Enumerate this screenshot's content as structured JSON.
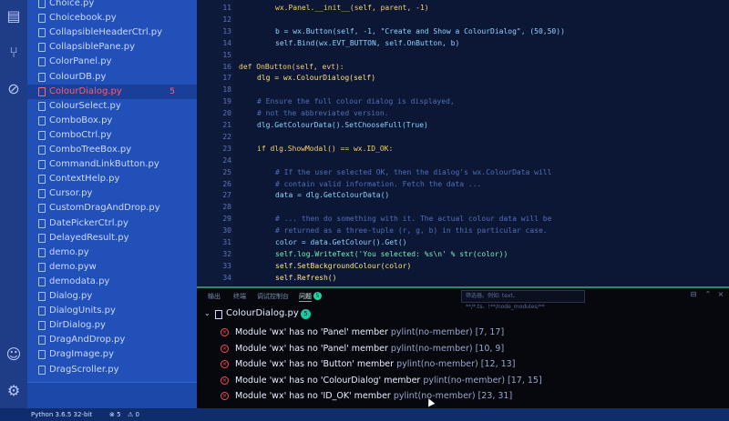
{
  "sidebar": {
    "files": [
      {
        "name": "Choice.py"
      },
      {
        "name": "Choicebook.py"
      },
      {
        "name": "CollapsibleHeaderCtrl.py"
      },
      {
        "name": "CollapsiblePane.py"
      },
      {
        "name": "ColorPanel.py"
      },
      {
        "name": "ColourDB.py"
      },
      {
        "name": "ColourDialog.py",
        "active": true,
        "badge": "5"
      },
      {
        "name": "ColourSelect.py"
      },
      {
        "name": "ComboBox.py"
      },
      {
        "name": "ComboCtrl.py"
      },
      {
        "name": "ComboTreeBox.py"
      },
      {
        "name": "CommandLinkButton.py"
      },
      {
        "name": "ContextHelp.py"
      },
      {
        "name": "Cursor.py"
      },
      {
        "name": "CustomDragAndDrop.py"
      },
      {
        "name": "DatePickerCtrl.py"
      },
      {
        "name": "DelayedResult.py"
      },
      {
        "name": "demo.py"
      },
      {
        "name": "demo.pyw"
      },
      {
        "name": "demodata.py"
      },
      {
        "name": "Dialog.py"
      },
      {
        "name": "DialogUnits.py"
      },
      {
        "name": "DirDialog.py"
      },
      {
        "name": "DragAndDrop.py"
      },
      {
        "name": "DragImage.py"
      },
      {
        "name": "DragScroller.py"
      }
    ]
  },
  "editor": {
    "line_numbers": [
      "11",
      "12",
      "13",
      "14",
      "15",
      "16",
      "17",
      "18",
      "19",
      "20",
      "21",
      "22",
      "23",
      "24",
      "25",
      "26",
      "27",
      "28",
      "29",
      "30",
      "31",
      "32",
      "33",
      "34"
    ],
    "lines": [
      {
        "text": "wx.Panel.__init__(self, parent, -1)",
        "cls": "kw",
        "indent": 4
      },
      {
        "text": "",
        "cls": "",
        "indent": 0
      },
      {
        "text": "b = wx.Button(self, -1, \"Create and Show a ColourDialog\", (50,50))",
        "cls": "",
        "indent": 4
      },
      {
        "text": "self.Bind(wx.EVT_BUTTON, self.OnButton, b)",
        "cls": "",
        "indent": 4
      },
      {
        "text": "",
        "cls": "",
        "indent": 0
      },
      {
        "text": "def OnButton(self, evt):",
        "cls": "kw",
        "indent": 0
      },
      {
        "text": "dlg = wx.ColourDialog(self)",
        "cls": "hl",
        "indent": 2
      },
      {
        "text": "",
        "cls": "",
        "indent": 0
      },
      {
        "text": "# Ensure the full colour dialog is displayed,",
        "cls": "comment",
        "indent": 2
      },
      {
        "text": "# not the abbreviated version.",
        "cls": "comment",
        "indent": 2
      },
      {
        "text": "dlg.GetColourData().SetChooseFull(True)",
        "cls": "",
        "indent": 2
      },
      {
        "text": "",
        "cls": "",
        "indent": 0
      },
      {
        "text": "if dlg.ShowModal() == wx.ID_OK:",
        "cls": "kw",
        "indent": 2
      },
      {
        "text": "",
        "cls": "",
        "indent": 0
      },
      {
        "text": "# If the user selected OK, then the dialog's wx.ColourData will",
        "cls": "comment",
        "indent": 4
      },
      {
        "text": "# contain valid information. Fetch the data ...",
        "cls": "comment",
        "indent": 4
      },
      {
        "text": "data = dlg.GetColourData()",
        "cls": "",
        "indent": 4
      },
      {
        "text": "",
        "cls": "",
        "indent": 0
      },
      {
        "text": "# ... then do something with it. The actual colour data will be",
        "cls": "comment",
        "indent": 4
      },
      {
        "text": "# returned as a three-tuple (r, g, b) in this particular case.",
        "cls": "comment",
        "indent": 4
      },
      {
        "text": "color = data.GetColour().Get()",
        "cls": "",
        "indent": 4
      },
      {
        "text": "self.log.WriteText('You selected: %s\\n' % str(color))",
        "cls": "str",
        "indent": 4
      },
      {
        "text": "self.SetBackgroundColour(color)",
        "cls": "hl",
        "indent": 4
      },
      {
        "text": "self.Refresh()",
        "cls": "hl",
        "indent": 4
      }
    ]
  },
  "panel": {
    "tabs": [
      "输出",
      "终端",
      "调试控制台",
      "问题"
    ],
    "problem_count": "5",
    "filter_placeholder": "筛选器。例如: text、**/*.ts、!**/node_modules/**",
    "file": "ColourDialog.py",
    "file_count": "5",
    "problems": [
      {
        "msg": "Module 'wx' has no 'Panel' member",
        "src": "pylint(no-member) [7, 17]"
      },
      {
        "msg": "Module 'wx' has no 'Panel' member",
        "src": "pylint(no-member) [10, 9]"
      },
      {
        "msg": "Module 'wx' has no 'Button' member",
        "src": "pylint(no-member) [12, 13]"
      },
      {
        "msg": "Module 'wx' has no 'ColourDialog' member",
        "src": "pylint(no-member) [17, 15]"
      },
      {
        "msg": "Module 'wx' has no 'ID_OK' member",
        "src": "pylint(no-member) [23, 31]"
      }
    ]
  },
  "statusbar": {
    "interpreter": "Python 3.6.5 32-bit",
    "errors": "⊗ 5",
    "warnings": "⚠ 0"
  },
  "colors": {
    "sidebar": "#2150b9",
    "editor": "#0c1735",
    "panel": "#06080e",
    "error": "#ff4a5a",
    "accent": "#2bd3a2"
  }
}
